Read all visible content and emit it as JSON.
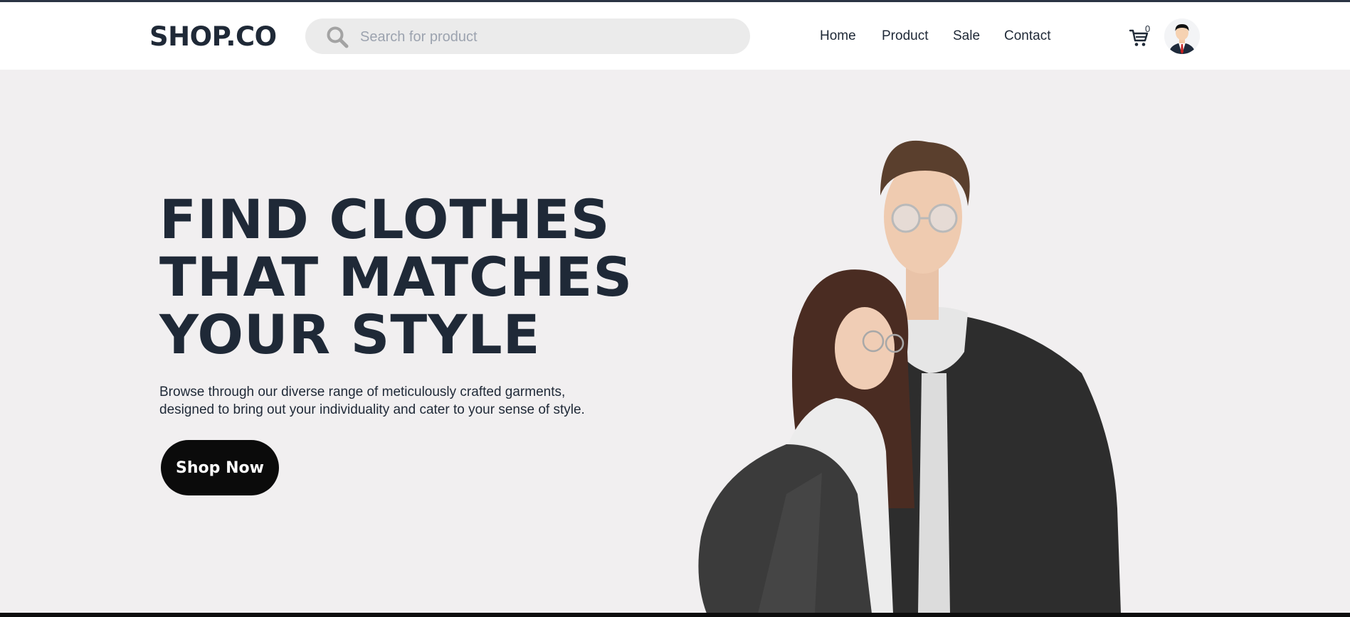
{
  "header": {
    "logo": "SHOP.CO",
    "search": {
      "placeholder": "Search for product",
      "value": "",
      "icon": "search-icon"
    },
    "nav": [
      {
        "label": "Home"
      },
      {
        "label": "Product"
      },
      {
        "label": "Sale"
      },
      {
        "label": "Contact"
      }
    ],
    "cart": {
      "icon": "cart-icon",
      "count": "0"
    },
    "avatar": {
      "icon": "user-avatar"
    }
  },
  "hero": {
    "title_lines": [
      "FIND CLOTHES",
      "THAT MATCHES",
      "YOUR STYLE"
    ],
    "description_lines": [
      "Browse through our diverse range of meticulously crafted garments,",
      "designed to bring out your individuality and cater to your sense of style."
    ],
    "cta_label": "Shop Now"
  },
  "colors": {
    "background": "#f1eff0",
    "header_bg": "#ffffff",
    "text": "#1f2937",
    "button_bg": "#0b0b0b",
    "button_text": "#ffffff",
    "search_bg": "#ebebeb"
  }
}
